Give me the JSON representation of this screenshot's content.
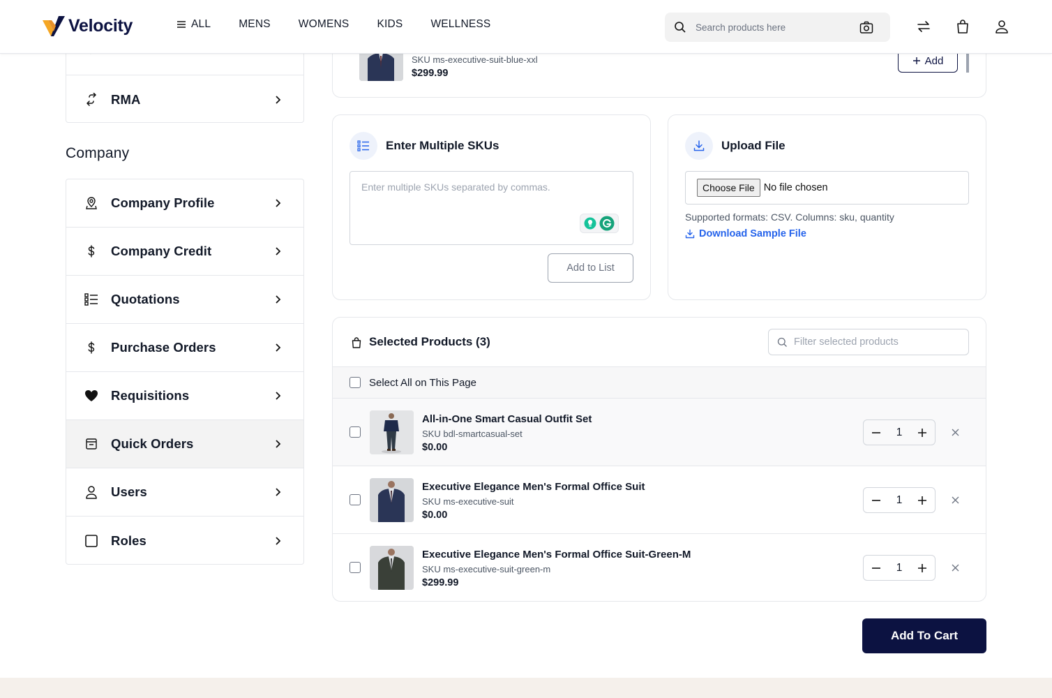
{
  "header": {
    "brand": "Velocity",
    "nav": [
      "ALL",
      "MENS",
      "WOMENS",
      "KIDS",
      "WELLNESS"
    ],
    "search_placeholder": "Search products here",
    "colors": {
      "brand_navy": "#0c1241",
      "brand_yellow": "#f5a623",
      "link_blue": "#2563eb"
    }
  },
  "sidebar": {
    "top_items": [
      {
        "label": "RMA",
        "icon": "return-arrows-icon"
      }
    ],
    "company_heading": "Company",
    "company_items": [
      {
        "label": "Company Profile",
        "icon": "company-profile-icon"
      },
      {
        "label": "Company Credit",
        "icon": "dollar-icon"
      },
      {
        "label": "Quotations",
        "icon": "list-icon"
      },
      {
        "label": "Purchase Orders",
        "icon": "dollar-icon"
      },
      {
        "label": "Requisitions",
        "icon": "heart-icon"
      },
      {
        "label": "Quick Orders",
        "icon": "quick-order-icon",
        "active": true
      },
      {
        "label": "Users",
        "icon": "user-icon"
      },
      {
        "label": "Roles",
        "icon": "square-icon"
      }
    ]
  },
  "search_result": {
    "sku": "SKU ms-executive-suit-blue-xxl",
    "price": "$299.99",
    "add_label": "Add"
  },
  "multi_sku": {
    "title": "Enter Multiple SKUs",
    "placeholder": "Enter multiple SKUs separated by commas.",
    "button": "Add to List"
  },
  "upload": {
    "title": "Upload File",
    "choose_label": "Choose File",
    "no_file": "No file chosen",
    "supported": "Supported formats: CSV. Columns: sku, quantity",
    "download_label": "Download Sample File"
  },
  "selected": {
    "title": "Selected Products (3)",
    "filter_placeholder": "Filter selected products",
    "select_all": "Select All on This Page",
    "products": [
      {
        "name": "All-in-One Smart Casual Outfit Set",
        "sku": "SKU bdl-smartcasual-set",
        "price": "$0.00",
        "qty": "1",
        "suit_color": "#1e2a4a"
      },
      {
        "name": "Executive Elegance Men's Formal Office Suit",
        "sku": "SKU ms-executive-suit",
        "price": "$0.00",
        "qty": "1",
        "suit_color": "#2a3556"
      },
      {
        "name": "Executive Elegance Men's Formal Office Suit-Green-M",
        "sku": "SKU ms-executive-suit-green-m",
        "price": "$299.99",
        "qty": "1",
        "suit_color": "#3a4038"
      }
    ]
  },
  "cart_button": "Add To Cart"
}
